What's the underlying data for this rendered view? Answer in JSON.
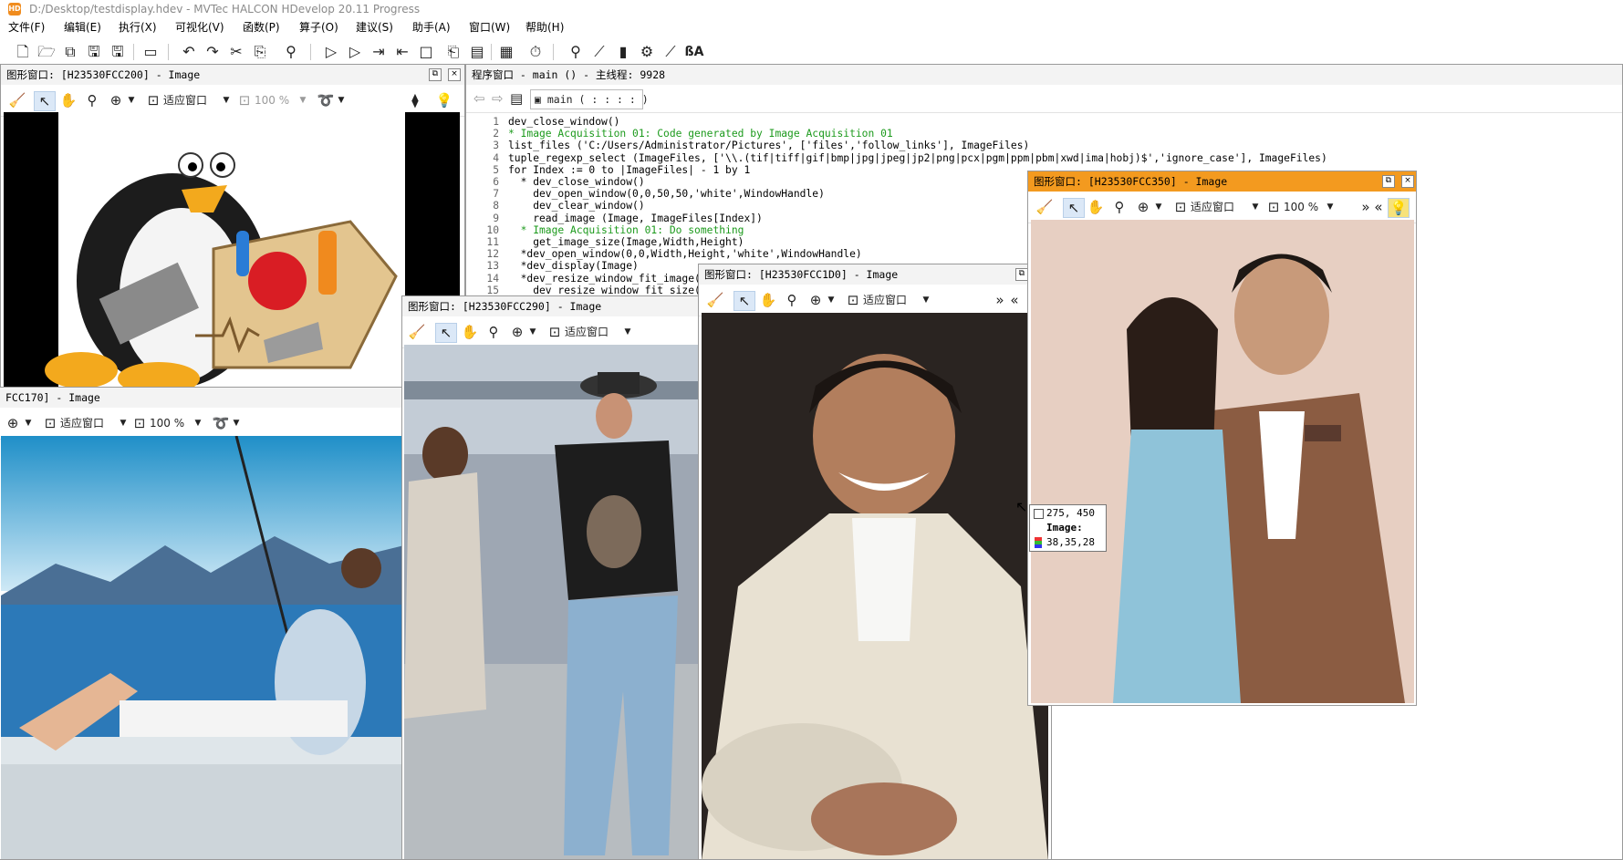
{
  "app": {
    "title": "D:/Desktop/testdisplay.hdev - MVTec HALCON HDevelop 20.11 Progress",
    "icon_text": "HD",
    "accent": "#f39a1f"
  },
  "menu": [
    "文件(F)",
    "编辑(E)",
    "执行(X)",
    "可视化(V)",
    "函数(P)",
    "算子(O)",
    "建议(S)",
    "助手(A)",
    "窗口(W)",
    "帮助(H)"
  ],
  "program_window": {
    "title": "程序窗口 - main () - 主线程: 9928",
    "proc_name": "main",
    "proc_sig": "( : : : : )",
    "lines": [
      {
        "n": "1",
        "text": "dev_close_window()",
        "comment": false
      },
      {
        "n": "2",
        "text": "* Image Acquisition 01: Code generated by Image Acquisition 01",
        "comment": true
      },
      {
        "n": "3",
        "text": "list_files ('C:/Users/Administrator/Pictures', ['files','follow_links'], ImageFiles)",
        "comment": false
      },
      {
        "n": "4",
        "text": "tuple_regexp_select (ImageFiles, ['\\\\.(tif|tiff|gif|bmp|jpg|jpeg|jp2|png|pcx|pgm|ppm|pbm|xwd|ima|hobj)$','ignore_case'], ImageFiles)",
        "comment": false
      },
      {
        "n": "5",
        "text": "for Index := 0 to |ImageFiles| - 1 by 1",
        "comment": false
      },
      {
        "n": "6",
        "text": "  * dev_close_window()",
        "comment": false
      },
      {
        "n": "7",
        "text": "    dev_open_window(0,0,50,50,'white',WindowHandle)",
        "comment": false
      },
      {
        "n": "8",
        "text": "    dev_clear_window()",
        "comment": false
      },
      {
        "n": "9",
        "text": "    read_image (Image, ImageFiles[Index])",
        "comment": false
      },
      {
        "n": "10",
        "text": "  * Image Acquisition 01: Do something",
        "comment": true
      },
      {
        "n": "11",
        "text": "    get_image_size(Image,Width,Height)",
        "comment": false
      },
      {
        "n": "12",
        "text": "  *dev_open_window(0,0,Width,Height,'white',WindowHandle)",
        "comment": false
      },
      {
        "n": "13",
        "text": "  *dev_display(Image)",
        "comment": false
      },
      {
        "n": "14",
        "text": "  *dev_resize_window_fit_image(In",
        "comment": false
      },
      {
        "n": "15",
        "text": "    dev_resize_window_fit_size(0,",
        "comment": false
      }
    ]
  },
  "windows": {
    "w200": {
      "title": "图形窗口: [H23530FCC200] - Image",
      "fit": "适应窗口",
      "zoom": "100 %"
    },
    "w170": {
      "title": "FCC170] - Image",
      "fit": "适应窗口",
      "zoom": "100 %"
    },
    "w290": {
      "title": "图形窗口: [H23530FCC290] - Image",
      "fit": "适应窗口"
    },
    "w1d0": {
      "title": "图形窗口: [H23530FCC1D0] - Image",
      "fit": "适应窗口"
    },
    "w350": {
      "title": "图形窗口: [H23530FCC350] - Image",
      "fit": "适应窗口",
      "zoom": "100 %"
    }
  },
  "tooltip": {
    "coords": "275, 450",
    "label": "Image:",
    "value": "38,35,28"
  }
}
